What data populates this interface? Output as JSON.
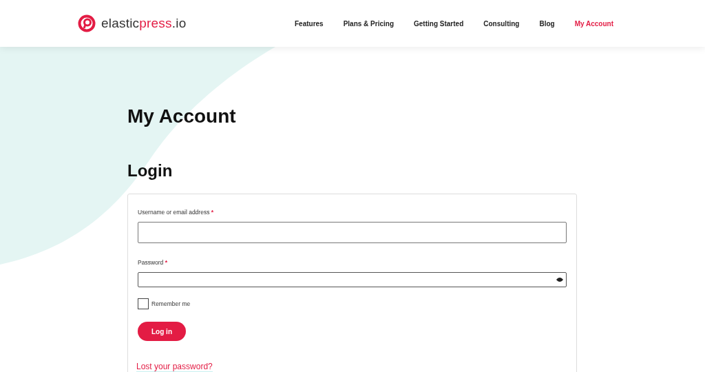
{
  "logo": {
    "parts": [
      {
        "text": "elastic",
        "accent": false
      },
      {
        "text": "press",
        "accent": true
      },
      {
        "text": ".io",
        "accent": false
      }
    ]
  },
  "nav": [
    {
      "label": "Features",
      "selected": false
    },
    {
      "label": "Plans & Pricing",
      "selected": false
    },
    {
      "label": "Getting Started",
      "selected": false
    },
    {
      "label": "Consulting",
      "selected": false
    },
    {
      "label": "Blog",
      "selected": false
    },
    {
      "label": "My Account",
      "selected": true
    }
  ],
  "page_title": "My Account",
  "login": {
    "heading": "Login",
    "fields": [
      {
        "label": "Username or email address",
        "required_mark": "*",
        "kind": "text"
      },
      {
        "label": "Password",
        "required_mark": "*",
        "kind": "password"
      }
    ],
    "remember": {
      "label": "Remember me",
      "checked": false
    },
    "submit": "Log in",
    "lost_password": "Lost your password?"
  }
}
